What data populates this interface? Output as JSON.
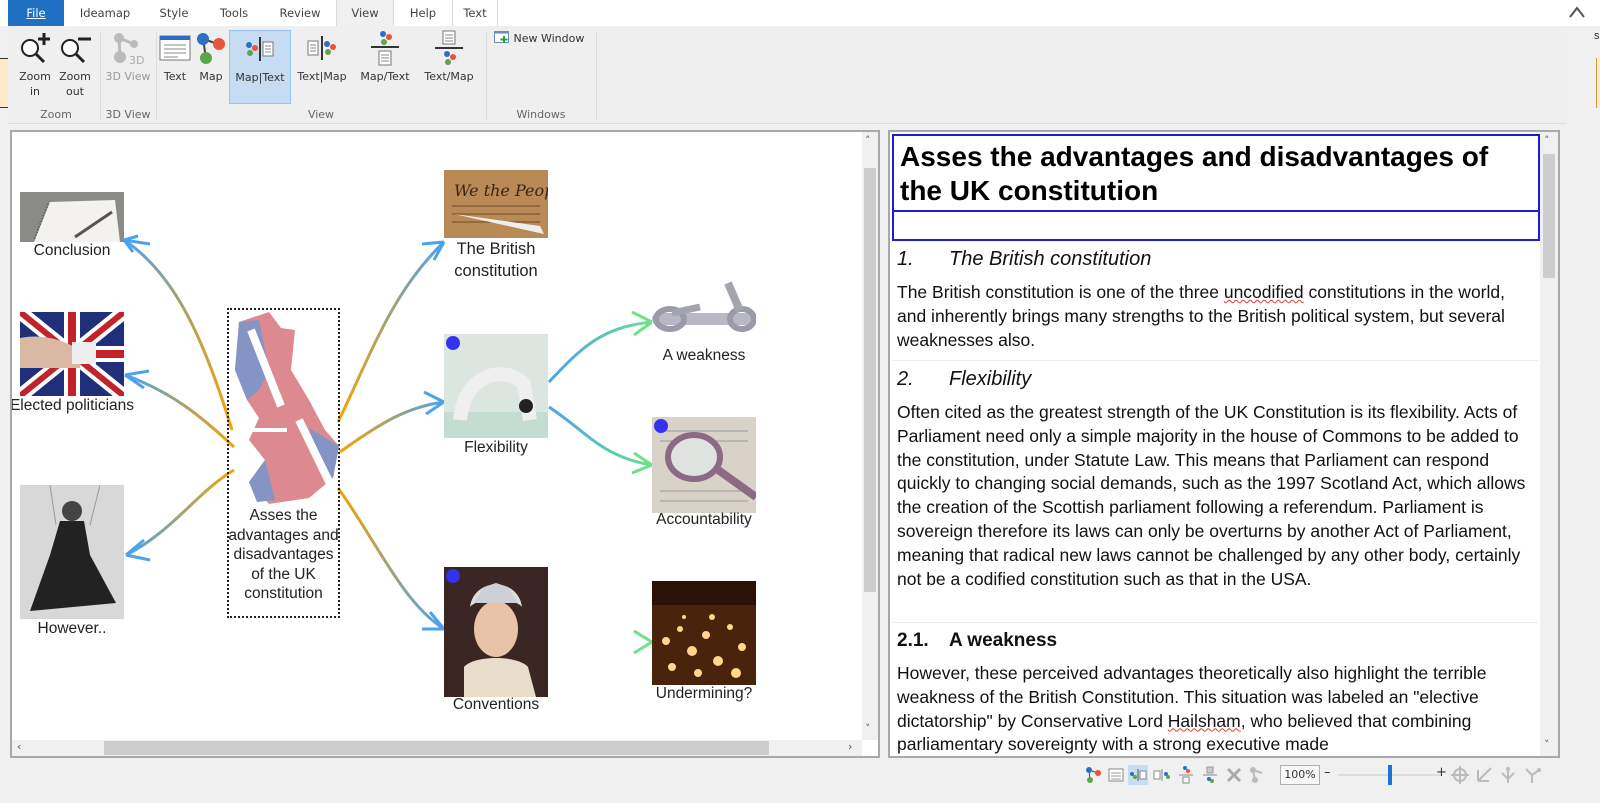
{
  "tabs": [
    {
      "label": "File",
      "active": false
    },
    {
      "label": "Ideamap",
      "active": false
    },
    {
      "label": "Style",
      "active": false
    },
    {
      "label": "Tools",
      "active": false
    },
    {
      "label": "Review",
      "active": false
    },
    {
      "label": "View",
      "active": true
    },
    {
      "label": "Help",
      "active": false
    },
    {
      "label": "Text",
      "active": false
    }
  ],
  "ribbon": {
    "zoom_in_label": "Zoom in",
    "zoom_out_label": "Zoom out",
    "view3d_label": "3D View",
    "text_label": "Text",
    "map_label": "Map",
    "map_text_label": "Map|Text",
    "text_map_label": "Text|Map",
    "map_over_text_label": "Map/Text",
    "text_over_map_label": "Text/Map",
    "new_window_label": "New Window",
    "groups": {
      "zoom": "Zoom",
      "view3d": "3D View",
      "view": "View",
      "windows": "Windows"
    },
    "selected_layout": "Map|Text",
    "edge_letter": "s"
  },
  "map": {
    "central": {
      "label": "Asses the advantages and disadvantages of the UK constitution"
    },
    "nodes": [
      {
        "id": "conclusion",
        "label": "Conclusion",
        "image": "notepad-pen",
        "marker": false
      },
      {
        "id": "elected",
        "label": "Elected politicians",
        "image": "ballot-union-jack",
        "marker": false
      },
      {
        "id": "however",
        "label": "However..",
        "image": "puppet-woman",
        "marker": false
      },
      {
        "id": "british",
        "label": "The British constitution",
        "image": "we-the-people-quill",
        "marker": false
      },
      {
        "id": "flexibility",
        "label": "Flexibility",
        "image": "backbend-person",
        "marker": true
      },
      {
        "id": "conventions",
        "label": "Conventions",
        "image": "queen-portrait",
        "marker": true
      },
      {
        "id": "weakness",
        "label": "A weakness",
        "image": "broken-chain",
        "marker": false
      },
      {
        "id": "accountability",
        "label": "Accountability",
        "image": "magnifying-glass",
        "marker": true
      },
      {
        "id": "undermining",
        "label": "Undermining?",
        "image": "hanging-lights",
        "marker": false
      }
    ],
    "colors": {
      "branch_start": "#f5a300",
      "branch_end": "#4aa3f0",
      "sub_end": "#6ee08a",
      "marker": "#3333ee"
    }
  },
  "document": {
    "title": "Asses the advantages and disadvantages of the UK constitution",
    "sections": [
      {
        "number": "1.",
        "heading": "The British constitution",
        "style": "h2",
        "paragraph_parts": [
          "The British constitution is one of the three ",
          "uncodified",
          " constitutions in the world, and inherently brings many strengths to the British political system, but several weaknesses also."
        ]
      },
      {
        "number": "2.",
        "heading": "Flexibility",
        "style": "h2",
        "paragraph_parts": [
          "Often cited as the greatest strength of the UK Constitution is its flexibility. Acts of Parliament need only a simple majority in the house of Commons to be added to the constitution, under Statute Law. This means that Parliament can respond quickly to changing social demands, such as the 1997 Scotland Act, which allows the creation of the Scottish parliament following a referendum. Parliament is sovereign therefore its laws can only be overturns by another Act of Parliament, meaning that radical new laws cannot be challenged by any other body, certainly not be a codified constitution such as that in the USA.",
          "",
          ""
        ]
      },
      {
        "number": "2.1.",
        "heading": "A weakness",
        "style": "h3",
        "paragraph_parts": [
          "However, these perceived advantages theoretically also highlight the terrible weakness of the British Constitution. This situation was labeled an \"elective dictatorship\" by Conservative Lord ",
          "Hailsham",
          ", who believed that combining parliamentary sovereignty with a strong executive made"
        ]
      }
    ]
  },
  "statusbar": {
    "zoom_value": "100%",
    "zoom_minus": "–",
    "zoom_plus": "+",
    "zoom_slider_fraction": 0.5,
    "icons": [
      "map-view-icon",
      "text-view-icon",
      "map-text-view-icon",
      "text-map-view-icon",
      "map-over-text-icon",
      "text-over-map-icon",
      "collapse-all-icon",
      "3d-view-icon"
    ],
    "right_icons": [
      "center-map-icon",
      "arrow-sw-icon",
      "branch-down-icon",
      "branch-star-icon"
    ]
  },
  "scroll": {
    "map_vertical_fraction": 0.1,
    "map_horizontal_fraction": 0.12,
    "text_vertical_fraction": 0.0
  }
}
